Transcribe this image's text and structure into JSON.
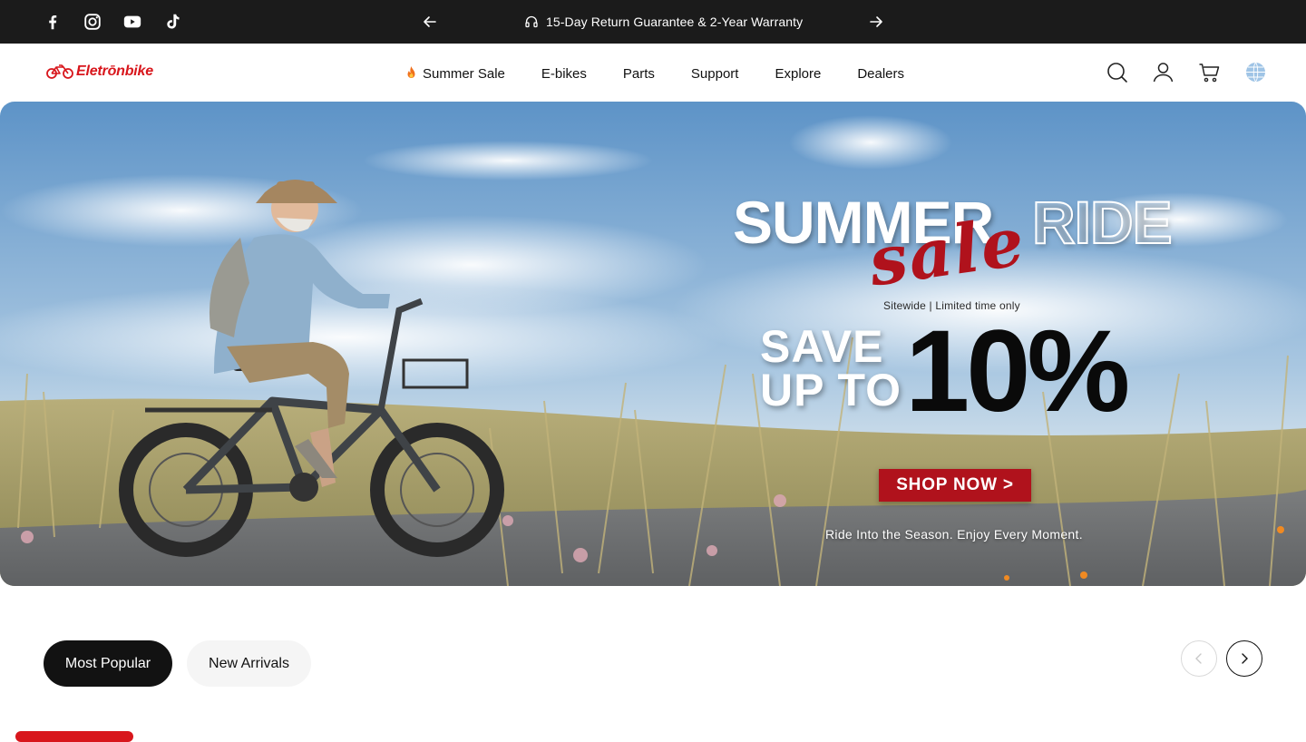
{
  "announcement": {
    "text": "15-Day Return Guarantee & 2-Year Warranty",
    "icon": "headset-icon",
    "prev_icon": "arrow-left-icon",
    "next_icon": "arrow-right-icon"
  },
  "social": [
    "facebook-icon",
    "instagram-icon",
    "youtube-icon",
    "tiktok-icon"
  ],
  "brand": {
    "name": "Eletrōnbike",
    "color": "#d8161c"
  },
  "nav": {
    "items": [
      {
        "label": "Summer Sale",
        "icon": "fire-icon"
      },
      {
        "label": "E-bikes"
      },
      {
        "label": "Parts"
      },
      {
        "label": "Support"
      },
      {
        "label": "Explore"
      },
      {
        "label": "Dealers"
      }
    ]
  },
  "header_icons": [
    "search-icon",
    "account-icon",
    "cart-icon",
    "globe-icon"
  ],
  "hero": {
    "headline_1": "SUMMER",
    "headline_2": "RIDE",
    "script": "sale",
    "subline": "Sitewide | Limited time only",
    "save_line_1": "SAVE",
    "save_line_2": "UP TO",
    "discount": "10%",
    "cta": "SHOP NOW >",
    "tagline": "Ride Into the Season. Enjoy Every Moment.",
    "accent": "#b0121c"
  },
  "tabs": [
    {
      "label": "Most Popular",
      "active": true
    },
    {
      "label": "New Arrivals",
      "active": false
    }
  ],
  "carousel": {
    "prev_icon": "chevron-left-icon",
    "next_icon": "chevron-right-icon"
  }
}
